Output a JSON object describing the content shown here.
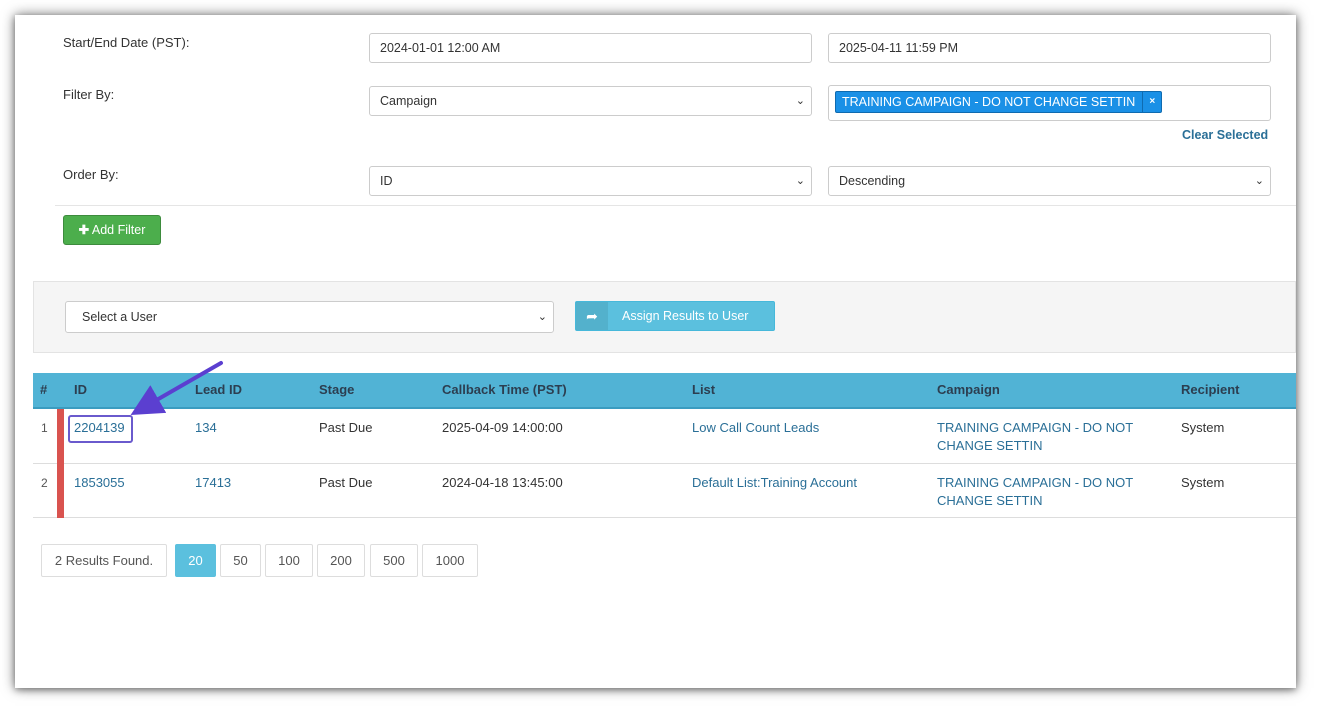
{
  "filters": {
    "date_label": "Start/End Date (PST):",
    "start_date": "2024-01-01 12:00 AM",
    "end_date": "2025-04-11 11:59 PM",
    "filter_by_label": "Filter By:",
    "filter_by_value": "Campaign",
    "selected_tag": "TRAINING CAMPAIGN - DO NOT CHANGE SETTIN",
    "tag_remove": "×",
    "clear_selected": "Clear Selected",
    "order_by_label": "Order By:",
    "order_by_value": "ID",
    "order_dir_value": "Descending",
    "add_filter": "Add Filter"
  },
  "assign": {
    "user_select": "Select a User",
    "assign_button": "Assign Results to User"
  },
  "table": {
    "columns": [
      "#",
      "ID",
      "Lead ID",
      "Stage",
      "Callback Time (PST)",
      "List",
      "Campaign",
      "Recipient"
    ],
    "rows": [
      {
        "num": "1",
        "id": "2204139",
        "lead_id": "134",
        "stage": "Past Due",
        "callback": "2025-04-09 14:00:00",
        "list": "Low Call Count Leads",
        "campaign_line1": "TRAINING CAMPAIGN - DO NOT",
        "campaign_line2": "CHANGE SETTIN",
        "recipient": "System"
      },
      {
        "num": "2",
        "id": "1853055",
        "lead_id": "17413",
        "stage": "Past Due",
        "callback": "2024-04-18 13:45:00",
        "list": "Default List:Training Account",
        "campaign_line1": "TRAINING CAMPAIGN - DO NOT",
        "campaign_line2": "CHANGE SETTIN",
        "recipient": "System"
      }
    ]
  },
  "pagination": {
    "results": "2 Results Found.",
    "sizes": [
      "20",
      "50",
      "100",
      "200",
      "500",
      "1000"
    ],
    "active": "20"
  },
  "colors": {
    "table_header": "#51b3d5",
    "link": "#2a6f97",
    "add_button": "#4cae4c",
    "row_marker": "#d9534f",
    "annotation": "#6a5acd"
  },
  "icons": {
    "add": "plus-icon",
    "assign": "share-arrow-icon",
    "dropdown": "chevron-down-icon",
    "annotation": "arrow-pointer"
  }
}
